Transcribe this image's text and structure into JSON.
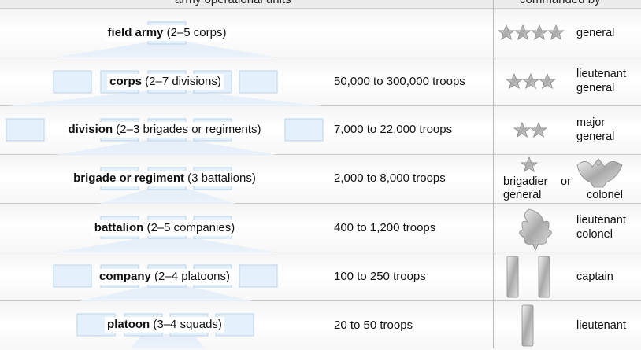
{
  "header": {
    "units_title": "army operational units",
    "commanded_title": "commanded by"
  },
  "rows": [
    {
      "unit_name": "field army",
      "unit_detail": " (2–5 corps)",
      "troops": "",
      "rank": "general"
    },
    {
      "unit_name": "corps",
      "unit_detail": " (2–7 divisions)",
      "troops": "50,000 to 300,000 troops",
      "rank": "lieutenant\ngeneral"
    },
    {
      "unit_name": "division",
      "unit_detail": " (2–3 brigades or regiments)",
      "troops": "7,000 to 22,000 troops",
      "rank": "major\ngeneral"
    },
    {
      "unit_name": "brigade or regiment",
      "unit_detail": " (3 battalions)",
      "troops": "2,000 to 8,000 troops",
      "rank": ""
    },
    {
      "unit_name": "battalion",
      "unit_detail": " (2–5 companies)",
      "troops": "400 to 1,200 troops",
      "rank": "lieutenant\ncolonel"
    },
    {
      "unit_name": "company",
      "unit_detail": " (2–4 platoons)",
      "troops": "100 to 250 troops",
      "rank": "captain"
    },
    {
      "unit_name": "platoon",
      "unit_detail": " (3–4 squads)",
      "troops": "20 to 50 troops",
      "rank": "lieutenant"
    }
  ],
  "brigade_ranks": {
    "left": "brigadier\ngeneral",
    "or": "or",
    "right": "colonel"
  },
  "insignia": [
    "four-stars-icon",
    "three-stars-icon",
    "two-stars-icon",
    "one-star-icon",
    "eagle-icon",
    "oak-leaf-icon",
    "double-bar-icon",
    "single-bar-icon"
  ]
}
